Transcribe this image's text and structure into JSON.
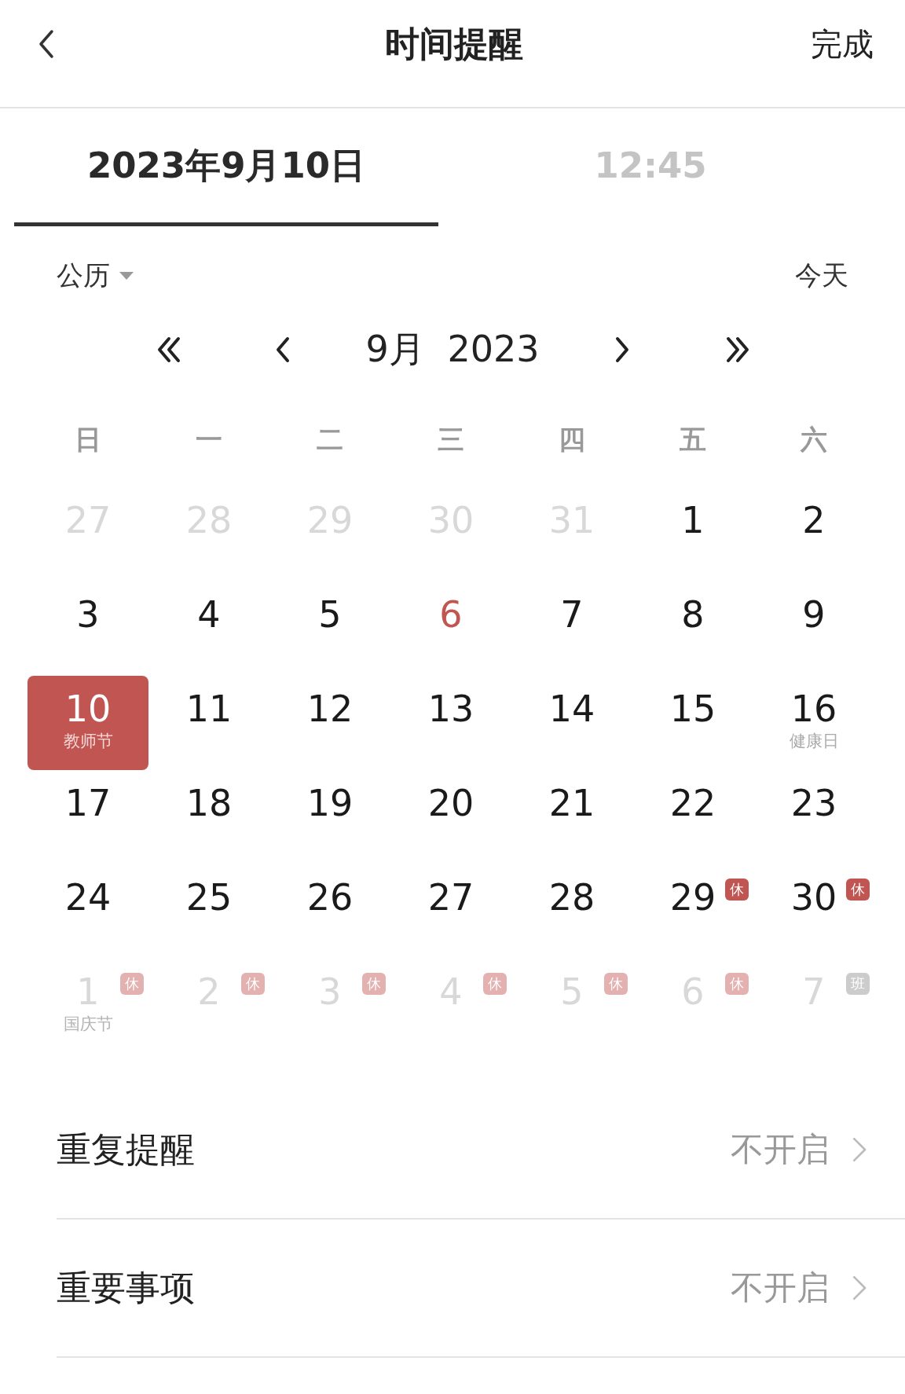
{
  "header": {
    "title": "时间提醒",
    "done": "完成"
  },
  "tabs": [
    {
      "label": "2023年9月10日",
      "selected": true
    },
    {
      "label": "12:45",
      "selected": false
    }
  ],
  "calendar_type": {
    "label": "公历"
  },
  "today_button": "今天",
  "month_nav": {
    "month": "9月",
    "year": "2023"
  },
  "weekdays": [
    "日",
    "一",
    "二",
    "三",
    "四",
    "五",
    "六"
  ],
  "days": [
    {
      "day": "27",
      "kind": "other",
      "selected": false
    },
    {
      "day": "28",
      "kind": "other",
      "selected": false
    },
    {
      "day": "29",
      "kind": "other",
      "selected": false
    },
    {
      "day": "30",
      "kind": "other",
      "selected": false
    },
    {
      "day": "31",
      "kind": "other",
      "selected": false
    },
    {
      "day": "1",
      "kind": "current",
      "selected": false
    },
    {
      "day": "2",
      "kind": "current",
      "selected": false
    },
    {
      "day": "3",
      "kind": "current",
      "selected": false
    },
    {
      "day": "4",
      "kind": "current",
      "selected": false
    },
    {
      "day": "5",
      "kind": "current",
      "selected": false
    },
    {
      "day": "6",
      "kind": "today",
      "selected": false
    },
    {
      "day": "7",
      "kind": "current",
      "selected": false
    },
    {
      "day": "8",
      "kind": "current",
      "selected": false
    },
    {
      "day": "9",
      "kind": "current",
      "selected": false
    },
    {
      "day": "10",
      "kind": "current",
      "selected": true,
      "label": "教师节"
    },
    {
      "day": "11",
      "kind": "current",
      "selected": false
    },
    {
      "day": "12",
      "kind": "current",
      "selected": false
    },
    {
      "day": "13",
      "kind": "current",
      "selected": false
    },
    {
      "day": "14",
      "kind": "current",
      "selected": false
    },
    {
      "day": "15",
      "kind": "current",
      "selected": false
    },
    {
      "day": "16",
      "kind": "current",
      "selected": false,
      "label": "健康日"
    },
    {
      "day": "17",
      "kind": "current",
      "selected": false
    },
    {
      "day": "18",
      "kind": "current",
      "selected": false
    },
    {
      "day": "19",
      "kind": "current",
      "selected": false
    },
    {
      "day": "20",
      "kind": "current",
      "selected": false
    },
    {
      "day": "21",
      "kind": "current",
      "selected": false
    },
    {
      "day": "22",
      "kind": "current",
      "selected": false
    },
    {
      "day": "23",
      "kind": "current",
      "selected": false
    },
    {
      "day": "24",
      "kind": "current",
      "selected": false
    },
    {
      "day": "25",
      "kind": "current",
      "selected": false
    },
    {
      "day": "26",
      "kind": "current",
      "selected": false
    },
    {
      "day": "27",
      "kind": "current",
      "selected": false
    },
    {
      "day": "28",
      "kind": "current",
      "selected": false
    },
    {
      "day": "29",
      "kind": "current",
      "selected": false,
      "badge": {
        "text": "休",
        "kind": "rest"
      }
    },
    {
      "day": "30",
      "kind": "current",
      "selected": false,
      "badge": {
        "text": "休",
        "kind": "rest"
      }
    },
    {
      "day": "1",
      "kind": "other",
      "selected": false,
      "label": "国庆节",
      "badge": {
        "text": "休",
        "kind": "rest"
      }
    },
    {
      "day": "2",
      "kind": "other",
      "selected": false,
      "badge": {
        "text": "休",
        "kind": "rest"
      }
    },
    {
      "day": "3",
      "kind": "other",
      "selected": false,
      "badge": {
        "text": "休",
        "kind": "rest"
      }
    },
    {
      "day": "4",
      "kind": "other",
      "selected": false,
      "badge": {
        "text": "休",
        "kind": "rest"
      }
    },
    {
      "day": "5",
      "kind": "other",
      "selected": false,
      "badge": {
        "text": "休",
        "kind": "rest"
      }
    },
    {
      "day": "6",
      "kind": "other",
      "selected": false,
      "badge": {
        "text": "休",
        "kind": "rest"
      }
    },
    {
      "day": "7",
      "kind": "other",
      "selected": false,
      "badge": {
        "text": "班",
        "kind": "work"
      }
    }
  ],
  "settings": [
    {
      "label": "重复提醒",
      "value": "不开启"
    },
    {
      "label": "重要事项",
      "value": "不开启"
    }
  ]
}
